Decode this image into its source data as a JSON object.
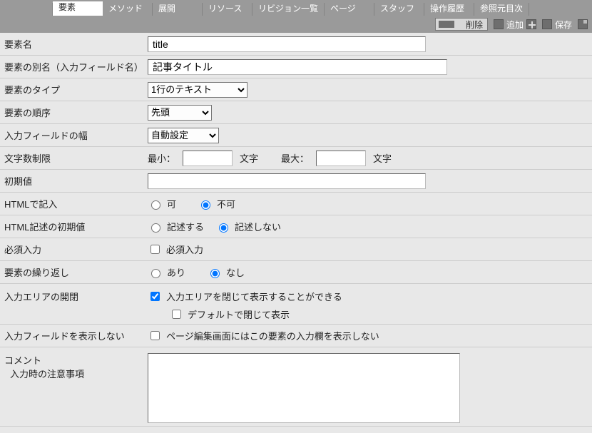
{
  "tabs": {
    "t0": "",
    "t1": "要素",
    "t2": "メソッド",
    "t3": "展開",
    "t4": "リソース",
    "t5": "リビジョン一覧",
    "t6": "ページ",
    "t7": "スタッフ",
    "t8": "操作履歴",
    "t9": "参照元目次"
  },
  "toolbar": {
    "delete": "削除",
    "add": "追加",
    "save": "保存"
  },
  "labels": {
    "name": "要素名",
    "alias": "要素の別名（入力フィールド名）",
    "type": "要素のタイプ",
    "order": "要素の順序",
    "width": "入力フィールドの幅",
    "charlimit": "文字数制限",
    "min": "最小：",
    "max": "最大：",
    "unit": "文字",
    "initval": "初期値",
    "html": "HTMLで記入",
    "htmlinit": "HTML記述の初期値",
    "required": "必須入力",
    "repeat": "要素の繰り返し",
    "collapse": "入力エリアの開閉",
    "hidefield": "入力フィールドを表示しない",
    "comment": "コメント",
    "comment_sub": "入力時の注意事項"
  },
  "values": {
    "name": "title",
    "alias": "記事タイトル",
    "type": "1行のテキスト",
    "order": "先頭",
    "width": "自動設定",
    "min": "",
    "max": "",
    "initval": "",
    "comment": ""
  },
  "options": {
    "yes": "可",
    "no": "不可",
    "write": "記述する",
    "nowrite": "記述しない",
    "req": "必須入力",
    "ari": "あり",
    "nashi": "なし",
    "collapse_can": "入力エリアを閉じて表示することができる",
    "collapse_default": "デフォルトで閉じて表示",
    "hidefield_text": "ページ編集画面にはこの要素の入力欄を表示しない"
  }
}
